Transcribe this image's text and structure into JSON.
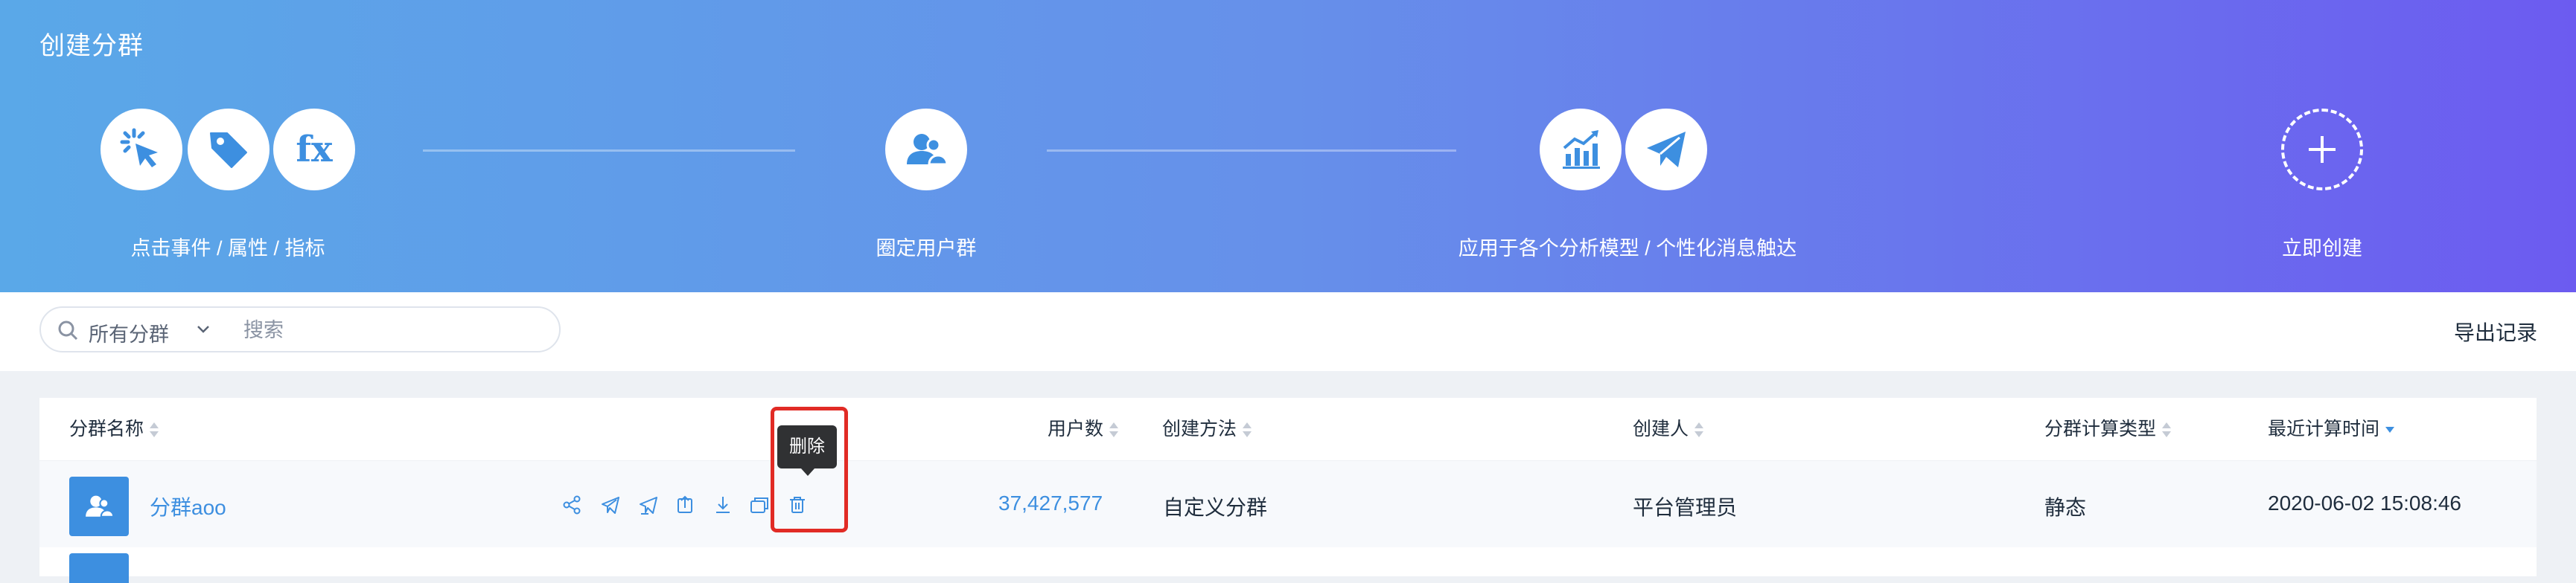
{
  "hero": {
    "title": "创建分群",
    "steps": [
      {
        "label": "点击事件 / 属性 / 指标",
        "icons": [
          "click-icon",
          "tag-icon",
          "fx-icon"
        ]
      },
      {
        "label": "圈定用户群",
        "icons": [
          "users-icon"
        ]
      },
      {
        "label": "应用于各个分析模型 / 个性化消息触达",
        "icons": [
          "chart-icon",
          "send-icon"
        ]
      },
      {
        "label": "立即创建",
        "icons": [
          "plus-icon"
        ]
      }
    ]
  },
  "toolbar": {
    "scope": "所有分群",
    "search_placeholder": "搜索",
    "export_label": "导出记录"
  },
  "table": {
    "columns": {
      "name": "分群名称",
      "users": "用户数",
      "method": "创建方法",
      "creator": "创建人",
      "calc_type": "分群计算类型",
      "last_calc": "最近计算时间"
    },
    "sorted_column": "最近计算时间",
    "sort_order": "descending",
    "rows": [
      {
        "name": "分群aoo",
        "users": "37,427,577",
        "method": "自定义分群",
        "creator": "平台管理员",
        "calc_type": "静态",
        "last_calc": "2020-06-02 15:08:46",
        "actions": [
          "share-icon",
          "send-icon",
          "send-edit-icon",
          "export-icon",
          "download-icon",
          "copy-icon",
          "delete-icon"
        ]
      }
    ]
  },
  "tooltip": {
    "text": "删除"
  },
  "colors": {
    "accent": "#3d8fe0",
    "hero_start": "#5aa8e8",
    "hero_end": "#6c5bf0",
    "highlight": "#e12b25"
  }
}
